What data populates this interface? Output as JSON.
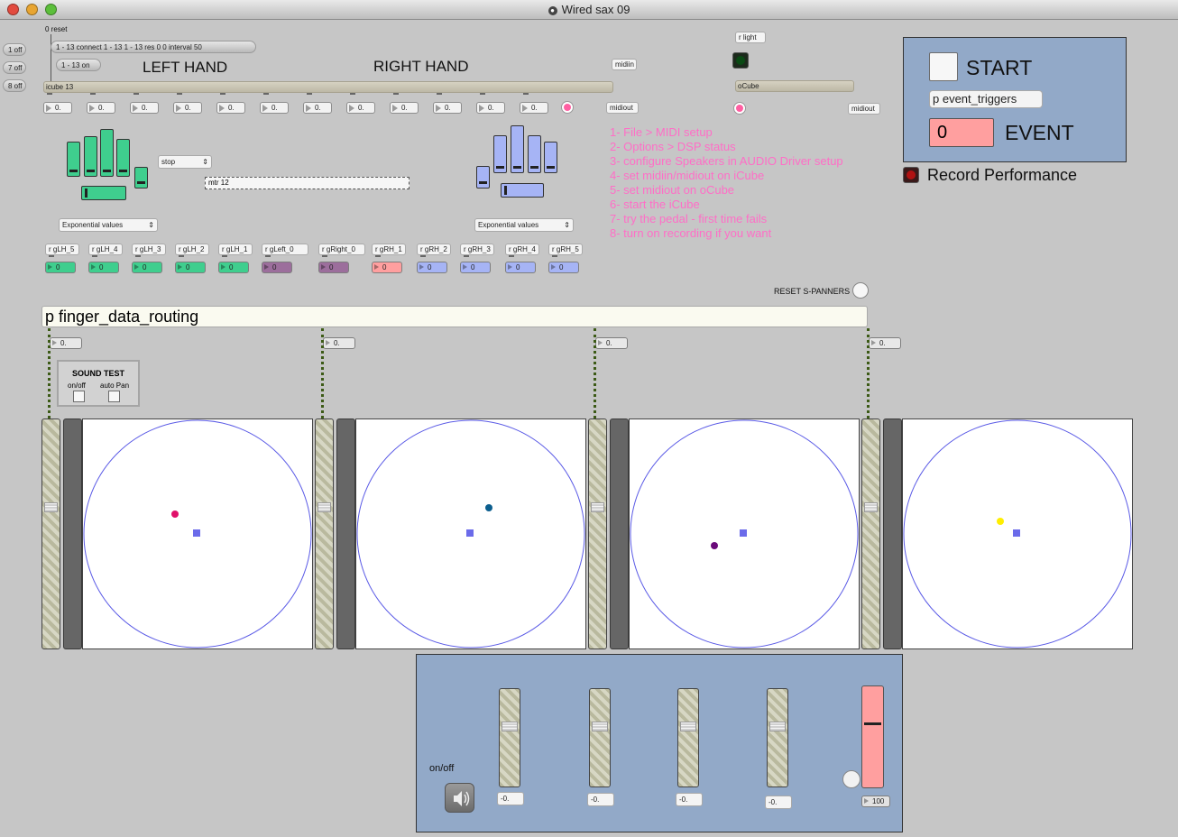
{
  "window": {
    "title": "Wired sax 09"
  },
  "colors": {
    "green": "#3fce8e",
    "blue": "#a6b4f5",
    "purple": "#9c6e9c",
    "pink": "#ff9f9f",
    "panel": "#92a9c8",
    "instructions": "#ff6ec7"
  },
  "top_messages": {
    "reset": "0 reset",
    "connect": "1 - 13 connect 1 - 13 1 - 13 res 0 0 interval 50",
    "on": "1 - 13 on",
    "off1": "1 off",
    "off7": "7 off",
    "off8": "8 off"
  },
  "icube": {
    "object": "icube 13",
    "left_hand": "LEFT HAND",
    "right_hand": "RIGHT HAND",
    "midiin": "midiin",
    "midiout": "midiout",
    "outputs": [
      "0.",
      "0.",
      "0.",
      "0.",
      "0.",
      "0.",
      "0.",
      "0.",
      "0.",
      "0.",
      "0.",
      "0."
    ]
  },
  "ocube": {
    "rlight": "r light",
    "object": "oCube",
    "midiout": "midiout"
  },
  "mtr": {
    "mode": "stop",
    "object": "mtr 12"
  },
  "menus": {
    "left": "Exponential values",
    "right": "Exponential values"
  },
  "receivers": [
    {
      "name": "r gLH_5",
      "value": "0",
      "color": "green"
    },
    {
      "name": "r gLH_4",
      "value": "0",
      "color": "green"
    },
    {
      "name": "r gLH_3",
      "value": "0",
      "color": "green"
    },
    {
      "name": "r gLH_2",
      "value": "0",
      "color": "green"
    },
    {
      "name": "r gLH_1",
      "value": "0",
      "color": "green"
    },
    {
      "name": "r gLeft_0",
      "value": "0",
      "color": "purple"
    },
    {
      "name": "r gRight_0",
      "value": "0",
      "color": "purple"
    },
    {
      "name": "r gRH_1",
      "value": "0",
      "color": "pink"
    },
    {
      "name": "r gRH_2",
      "value": "0",
      "color": "blue"
    },
    {
      "name": "r gRH_3",
      "value": "0",
      "color": "blue"
    },
    {
      "name": "r gRH_4",
      "value": "0",
      "color": "blue"
    },
    {
      "name": "r gRH_5",
      "value": "0",
      "color": "blue"
    }
  ],
  "instructions": [
    "1- File > MIDI setup",
    "2- Options > DSP status",
    "3- configure Speakers in AUDIO Driver setup",
    "4- set midiin/midiout on iCube",
    "5- set midiout on oCube",
    "6- start the iCube",
    "7- try the pedal - first time fails",
    "8- turn on recording if you want"
  ],
  "start_panel": {
    "start": "START",
    "object": "p event_triggers",
    "event_value": "0",
    "event": "EVENT"
  },
  "record": "Record Performance",
  "reset_panners": "RESET S-PANNERS",
  "routing": "p finger_data_routing",
  "routing_outputs": [
    "0.",
    "0.",
    "0.",
    "0."
  ],
  "sound_test": {
    "title": "SOUND TEST",
    "onoff": "on/off",
    "autopan": "auto Pan"
  },
  "panners": [
    {
      "dot_color": "#e0106a"
    },
    {
      "dot_color": "#0b5e8e"
    },
    {
      "dot_color": "#6a0a7a"
    },
    {
      "dot_color": "#ffee00"
    }
  ],
  "mixer": {
    "onoff": "on/off",
    "values": [
      "-0.",
      "-0.",
      "-0.",
      "-0."
    ],
    "master": "100"
  }
}
